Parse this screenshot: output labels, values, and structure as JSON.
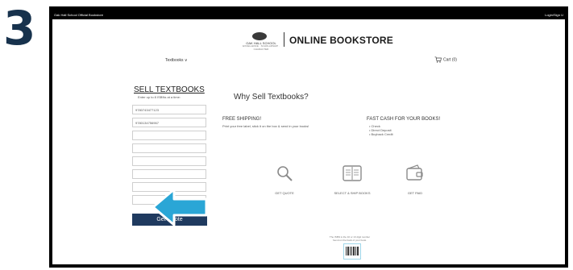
{
  "step_number": "3",
  "topbar": {
    "left_text": "Oak Hall School Official Bookstore",
    "right_text": "Login/Sign U"
  },
  "header": {
    "logo_line1": "OAK HALL SCHOOL",
    "logo_line2": "EXCELLENCE · SCHOLARSHIP · CHARACTER",
    "title": "ONLINE BOOKSTORE"
  },
  "nav": {
    "textbooks": "Textbooks ∨",
    "cart": "Cart (0)"
  },
  "sell": {
    "title": "SELL TEXTBOOKS",
    "subtitle": "Enter up to 8 ISBNs at a time:",
    "isbn_values": [
      "9780743477123",
      "9780134756967",
      "",
      "",
      "",
      "",
      "",
      ""
    ],
    "button": "Get Quote"
  },
  "why": {
    "title": "Why Sell Textbooks?",
    "shipping_heading": "FREE SHIPPING!",
    "shipping_text": "Print your free label, stick it on the box & send in your books!",
    "cash_heading": "FAST CASH FOR YOUR BOOKS!",
    "cash_options": [
      "Check",
      "Direct Deposit",
      "Buyback Credit"
    ]
  },
  "features": [
    {
      "label": "GET QUOTE",
      "icon": "magnifier-icon"
    },
    {
      "label": "SELECT & SHIP BOOKS",
      "icon": "book-icon"
    },
    {
      "label": "GET PAID",
      "icon": "wallet-icon"
    }
  ],
  "isbn_note": "The ISBN is the 10 or 13 digit number found on the back of your book.",
  "colors": {
    "button": "#1f3a5f",
    "arrow": "#2aa6d6",
    "step": "#17324d"
  }
}
